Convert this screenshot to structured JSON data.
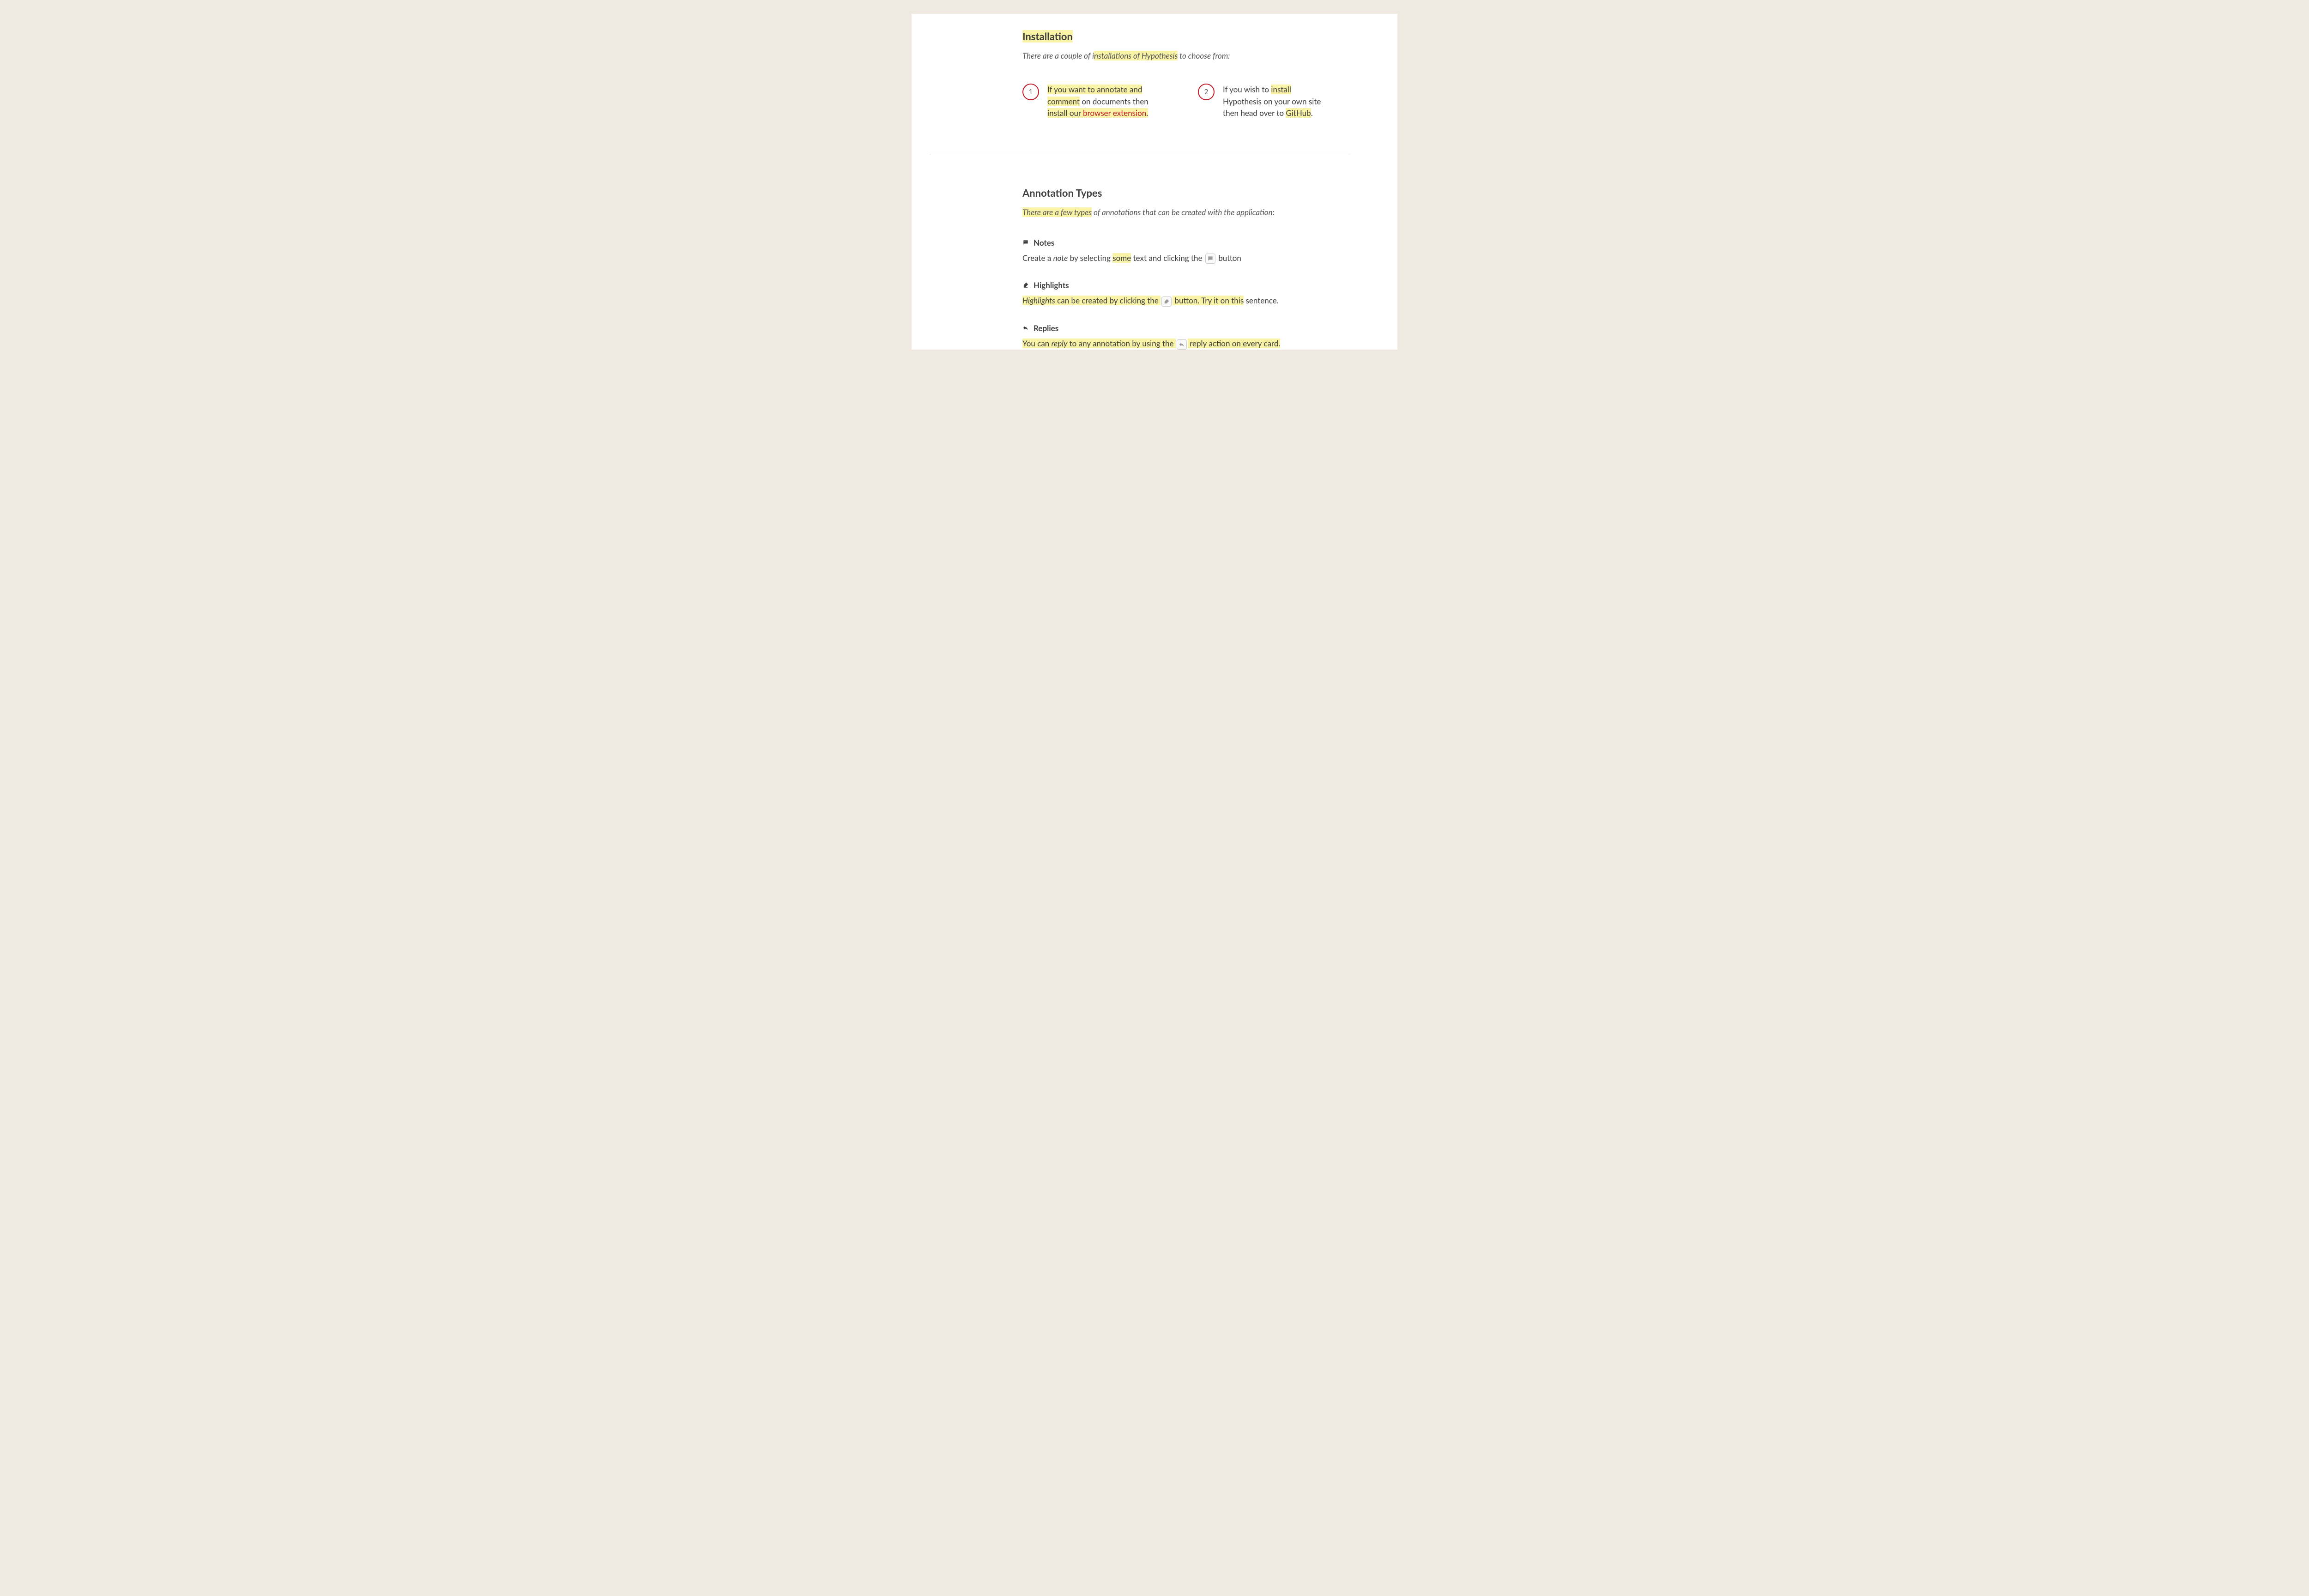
{
  "installation": {
    "heading": "Installation",
    "intro_before": "There are a couple of i",
    "intro_hl": "nstallations of Hypothesis",
    "intro_after": " to choose from:",
    "options": [
      {
        "num": "1",
        "segments": {
          "hl1_before": "If ",
          "hl1": "you want to annotate and comment",
          "after_hl1": " on documents then ",
          "hl2_before": "install our ",
          "link": "browser extension",
          "period": "."
        }
      },
      {
        "num": "2",
        "segments": {
          "before": "If you wish to ",
          "hl_install": "install",
          "middle": " Hypothesis on your own site then head over to ",
          "hl_github": "GitHub",
          "period": "."
        }
      }
    ]
  },
  "annotation_types": {
    "heading": "Annotation Types",
    "intro_hl1": "There are a ",
    "intro_hl2": "few types",
    "intro_after": " of annotations that can be created with the application:",
    "notes": {
      "title": "Notes",
      "before": "Create a ",
      "em": "note",
      "mid1": " by selecting ",
      "hl": "some",
      "mid2": " text and clicking the ",
      "after": " button"
    },
    "highlights": {
      "title": "Highlights",
      "hl_em": "Highlights",
      "hl_rest": " can be created by clicking the ",
      "mid": " button. Try it on ",
      "hl_this": "this",
      "after": " sentence."
    },
    "replies": {
      "title": "Replies",
      "hl_before": "You can ",
      "hl_em": "reply",
      "hl_rest": " to any annotation by using the ",
      "after": " reply action on every card."
    }
  }
}
